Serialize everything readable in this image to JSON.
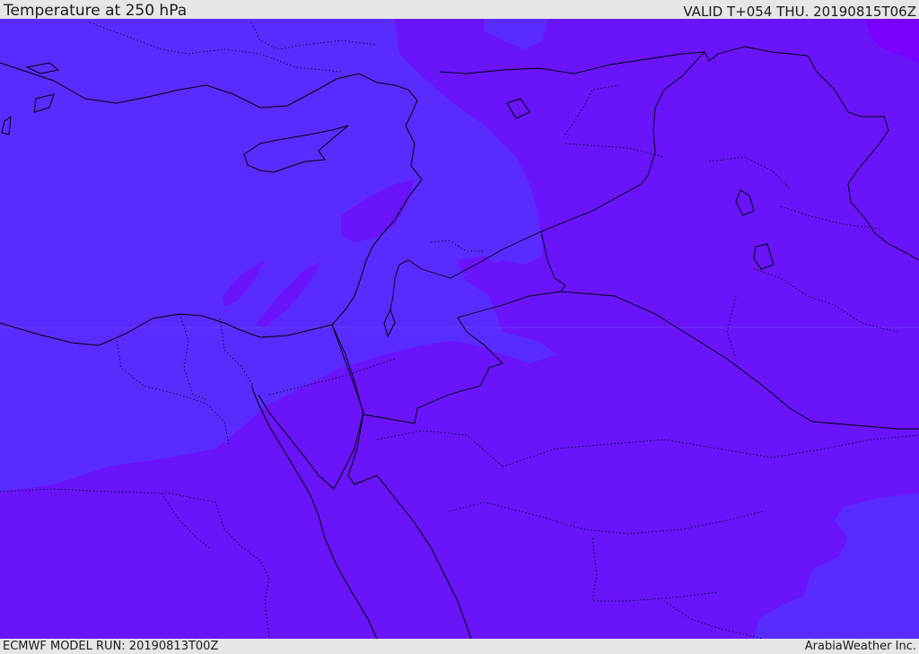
{
  "header": {
    "title": "Temperature at 250 hPa",
    "valid": "VALID T+054 THU. 20190815T06Z"
  },
  "footer": {
    "model_run": "ECMWF MODEL RUN: 20190813T00Z",
    "credit": "ArabiaWeather Inc."
  },
  "map": {
    "colors": {
      "zone_cool": "#5a2bff",
      "zone_warm": "#6a14fa",
      "zone_warmest": "#7a00fe",
      "coastline": "#000000"
    }
  }
}
